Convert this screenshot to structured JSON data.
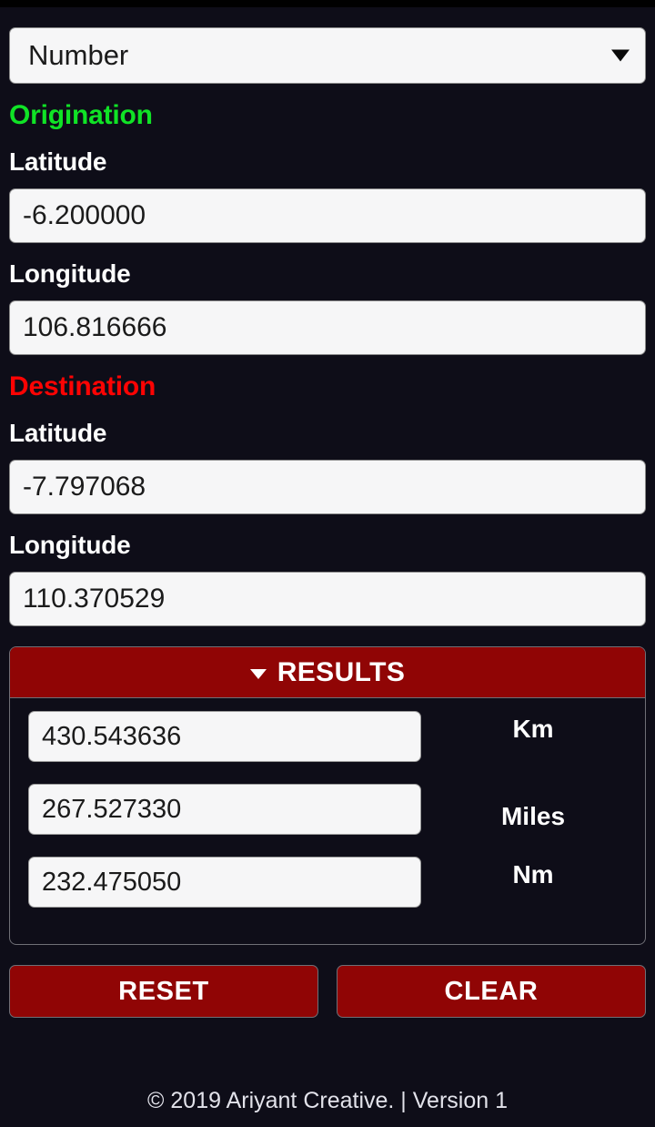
{
  "app": {
    "background": "#0e0d18",
    "accent_red": "#900505",
    "accent_green": "#10e326",
    "accent_destination": "#fd0303"
  },
  "mode_select": {
    "value": "Number",
    "icon": "chevron-down-icon"
  },
  "origination": {
    "heading": "Origination",
    "latitude_label": "Latitude",
    "latitude_value": "-6.200000",
    "longitude_label": "Longitude",
    "longitude_value": "106.816666"
  },
  "destination": {
    "heading": "Destination",
    "latitude_label": "Latitude",
    "latitude_value": "-7.797068",
    "longitude_label": "Longitude",
    "longitude_value": "110.370529"
  },
  "results": {
    "title": "RESULTS",
    "caret_icon": "caret-down-icon",
    "rows": [
      {
        "value": "430.543636",
        "unit": "Km"
      },
      {
        "value": "267.527330",
        "unit": "Miles"
      },
      {
        "value": "232.475050",
        "unit": "Nm"
      }
    ]
  },
  "actions": {
    "reset_label": "RESET",
    "clear_label": "CLEAR"
  },
  "footer": {
    "text": "© 2019 Ariyant Creative. | Version 1"
  }
}
